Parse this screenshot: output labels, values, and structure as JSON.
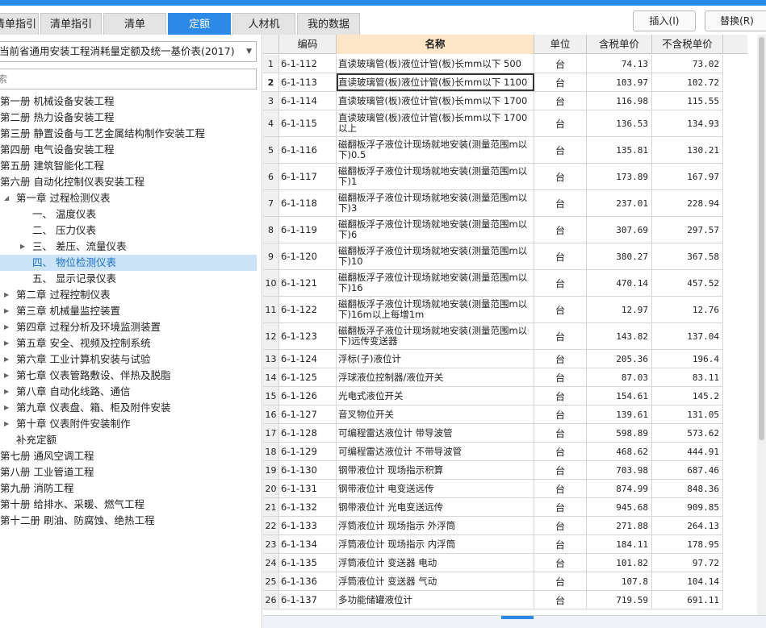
{
  "tabs": [
    "清单指引",
    "清单指引",
    "清单",
    "定额",
    "人材机",
    "我的数据"
  ],
  "toolbar": {
    "insert": "插入(I)",
    "replace": "替换(R)"
  },
  "library": {
    "selected": "当前省通用安装工程消耗量定额及统一基价表(2017)"
  },
  "search": {
    "placeholder": "搜索"
  },
  "tree": [
    {
      "label": "第一册 机械设备安装工程"
    },
    {
      "label": "第二册 热力设备安装工程"
    },
    {
      "label": "第三册 静置设备与工艺金属结构制作安装工程"
    },
    {
      "label": "第四册 电气设备安装工程"
    },
    {
      "label": "第五册 建筑智能化工程"
    },
    {
      "label": "第六册 自动化控制仪表安装工程"
    },
    {
      "label": "第一章 过程检测仪表"
    },
    {
      "label": "一、 温度仪表"
    },
    {
      "label": "二、 压力仪表"
    },
    {
      "label": "三、 差压、流量仪表"
    },
    {
      "label": "四、 物位检测仪表"
    },
    {
      "label": "五、 显示记录仪表"
    },
    {
      "label": "第二章 过程控制仪表"
    },
    {
      "label": "第三章 机械量监控装置"
    },
    {
      "label": "第四章 过程分析及环境监测装置"
    },
    {
      "label": "第五章 安全、视频及控制系统"
    },
    {
      "label": "第六章 工业计算机安装与试验"
    },
    {
      "label": "第七章 仪表管路敷设、伴热及脱脂"
    },
    {
      "label": "第八章 自动化线路、通信"
    },
    {
      "label": "第九章 仪表盘、箱、柜及附件安装"
    },
    {
      "label": "第十章 仪表附件安装制作"
    },
    {
      "label": "补充定额"
    },
    {
      "label": "第七册 通风空调工程"
    },
    {
      "label": "第八册 工业管道工程"
    },
    {
      "label": "第九册 消防工程"
    },
    {
      "label": "第十册 给排水、采暖、燃气工程"
    },
    {
      "label": "第十二册 刷油、防腐蚀、绝热工程"
    }
  ],
  "grid": {
    "headers": {
      "code": "编码",
      "name": "名称",
      "unit": "单位",
      "price_tax": "含税单价",
      "price_notax": "不含税单价"
    },
    "rows": [
      {
        "idx": "1",
        "code": "6-1-112",
        "name": "直读玻璃管(板)液位计管(板)长mm以下 500",
        "unit": "台",
        "p1": "74.13",
        "p2": "73.02"
      },
      {
        "idx": "2",
        "code": "6-1-113",
        "name": "直读玻璃管(板)液位计管(板)长mm以下 1100",
        "unit": "台",
        "p1": "103.97",
        "p2": "102.72"
      },
      {
        "idx": "3",
        "code": "6-1-114",
        "name": "直读玻璃管(板)液位计管(板)长mm以下 1700",
        "unit": "台",
        "p1": "116.98",
        "p2": "115.55"
      },
      {
        "idx": "4",
        "code": "6-1-115",
        "name": "直读玻璃管(板)液位计管(板)长mm以下 1700 以上",
        "unit": "台",
        "p1": "136.53",
        "p2": "134.93"
      },
      {
        "idx": "5",
        "code": "6-1-116",
        "name": "磁翻板浮子液位计现场就地安装(测量范围m以下)0.5",
        "unit": "台",
        "p1": "135.81",
        "p2": "130.21"
      },
      {
        "idx": "6",
        "code": "6-1-117",
        "name": "磁翻板浮子液位计现场就地安装(测量范围m以下)1",
        "unit": "台",
        "p1": "173.89",
        "p2": "167.97"
      },
      {
        "idx": "7",
        "code": "6-1-118",
        "name": "磁翻板浮子液位计现场就地安装(测量范围m以下)3",
        "unit": "台",
        "p1": "237.01",
        "p2": "228.94"
      },
      {
        "idx": "8",
        "code": "6-1-119",
        "name": "磁翻板浮子液位计现场就地安装(测量范围m以下)6",
        "unit": "台",
        "p1": "307.69",
        "p2": "297.57"
      },
      {
        "idx": "9",
        "code": "6-1-120",
        "name": "磁翻板浮子液位计现场就地安装(测量范围m以下)10",
        "unit": "台",
        "p1": "380.27",
        "p2": "367.58"
      },
      {
        "idx": "10",
        "code": "6-1-121",
        "name": "磁翻板浮子液位计现场就地安装(测量范围m以下)16",
        "unit": "台",
        "p1": "470.14",
        "p2": "457.52"
      },
      {
        "idx": "11",
        "code": "6-1-122",
        "name": "磁翻板浮子液位计现场就地安装(测量范围m以下)16m以上每增1m",
        "unit": "台",
        "p1": "12.97",
        "p2": "12.76"
      },
      {
        "idx": "12",
        "code": "6-1-123",
        "name": "磁翻板浮子液位计现场就地安装(测量范围m以下)远传变送器",
        "unit": "台",
        "p1": "143.82",
        "p2": "137.04"
      },
      {
        "idx": "13",
        "code": "6-1-124",
        "name": "浮标(子)液位计",
        "unit": "台",
        "p1": "205.36",
        "p2": "196.4"
      },
      {
        "idx": "14",
        "code": "6-1-125",
        "name": "浮球液位控制器/液位开关",
        "unit": "台",
        "p1": "87.03",
        "p2": "83.11"
      },
      {
        "idx": "15",
        "code": "6-1-126",
        "name": "光电式液位开关",
        "unit": "台",
        "p1": "154.61",
        "p2": "145.2"
      },
      {
        "idx": "16",
        "code": "6-1-127",
        "name": "音叉物位开关",
        "unit": "台",
        "p1": "139.61",
        "p2": "131.05"
      },
      {
        "idx": "17",
        "code": "6-1-128",
        "name": "可编程雷达液位计 带导波管",
        "unit": "台",
        "p1": "598.89",
        "p2": "573.62"
      },
      {
        "idx": "18",
        "code": "6-1-129",
        "name": "可编程雷达液位计 不带导波管",
        "unit": "台",
        "p1": "468.62",
        "p2": "444.91"
      },
      {
        "idx": "19",
        "code": "6-1-130",
        "name": "钢带液位计 现场指示积算",
        "unit": "台",
        "p1": "703.98",
        "p2": "687.46"
      },
      {
        "idx": "20",
        "code": "6-1-131",
        "name": "钢带液位计 电变送远传",
        "unit": "台",
        "p1": "874.99",
        "p2": "848.36"
      },
      {
        "idx": "21",
        "code": "6-1-132",
        "name": "钢带液位计 光电变送远传",
        "unit": "台",
        "p1": "945.68",
        "p2": "909.85"
      },
      {
        "idx": "22",
        "code": "6-1-133",
        "name": "浮筒液位计 现场指示 外浮筒",
        "unit": "台",
        "p1": "271.88",
        "p2": "264.13"
      },
      {
        "idx": "23",
        "code": "6-1-134",
        "name": "浮筒液位计 现场指示 内浮筒",
        "unit": "台",
        "p1": "184.11",
        "p2": "178.95"
      },
      {
        "idx": "24",
        "code": "6-1-135",
        "name": "浮筒液位计 变送器 电动",
        "unit": "台",
        "p1": "101.82",
        "p2": "97.72"
      },
      {
        "idx": "25",
        "code": "6-1-136",
        "name": "浮筒液位计 变送器 气动",
        "unit": "台",
        "p1": "107.8",
        "p2": "104.14"
      },
      {
        "idx": "26",
        "code": "6-1-137",
        "name": "多功能储罐液位计",
        "unit": "台",
        "p1": "719.59",
        "p2": "691.11"
      }
    ]
  }
}
